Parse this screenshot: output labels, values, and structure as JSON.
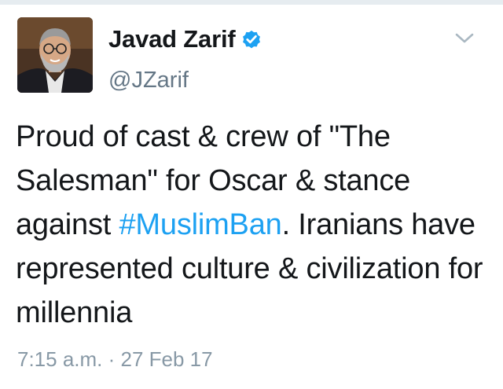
{
  "author": {
    "display_name": "Javad Zarif",
    "handle": "@JZarif",
    "verified": true
  },
  "tweet": {
    "text_before": "Proud of cast & crew of \"The Salesman\" for Oscar & stance against ",
    "hashtag": "#MuslimBan",
    "text_after": ". Iranians have represented culture & civilization for millennia",
    "timestamp": "7:15 a.m. · 27 Feb 17"
  },
  "icons": {
    "verified": "verified-badge-icon",
    "menu": "chevron-down-icon"
  },
  "colors": {
    "accent": "#1da1f2",
    "text": "#14171a",
    "muted": "#657786"
  }
}
